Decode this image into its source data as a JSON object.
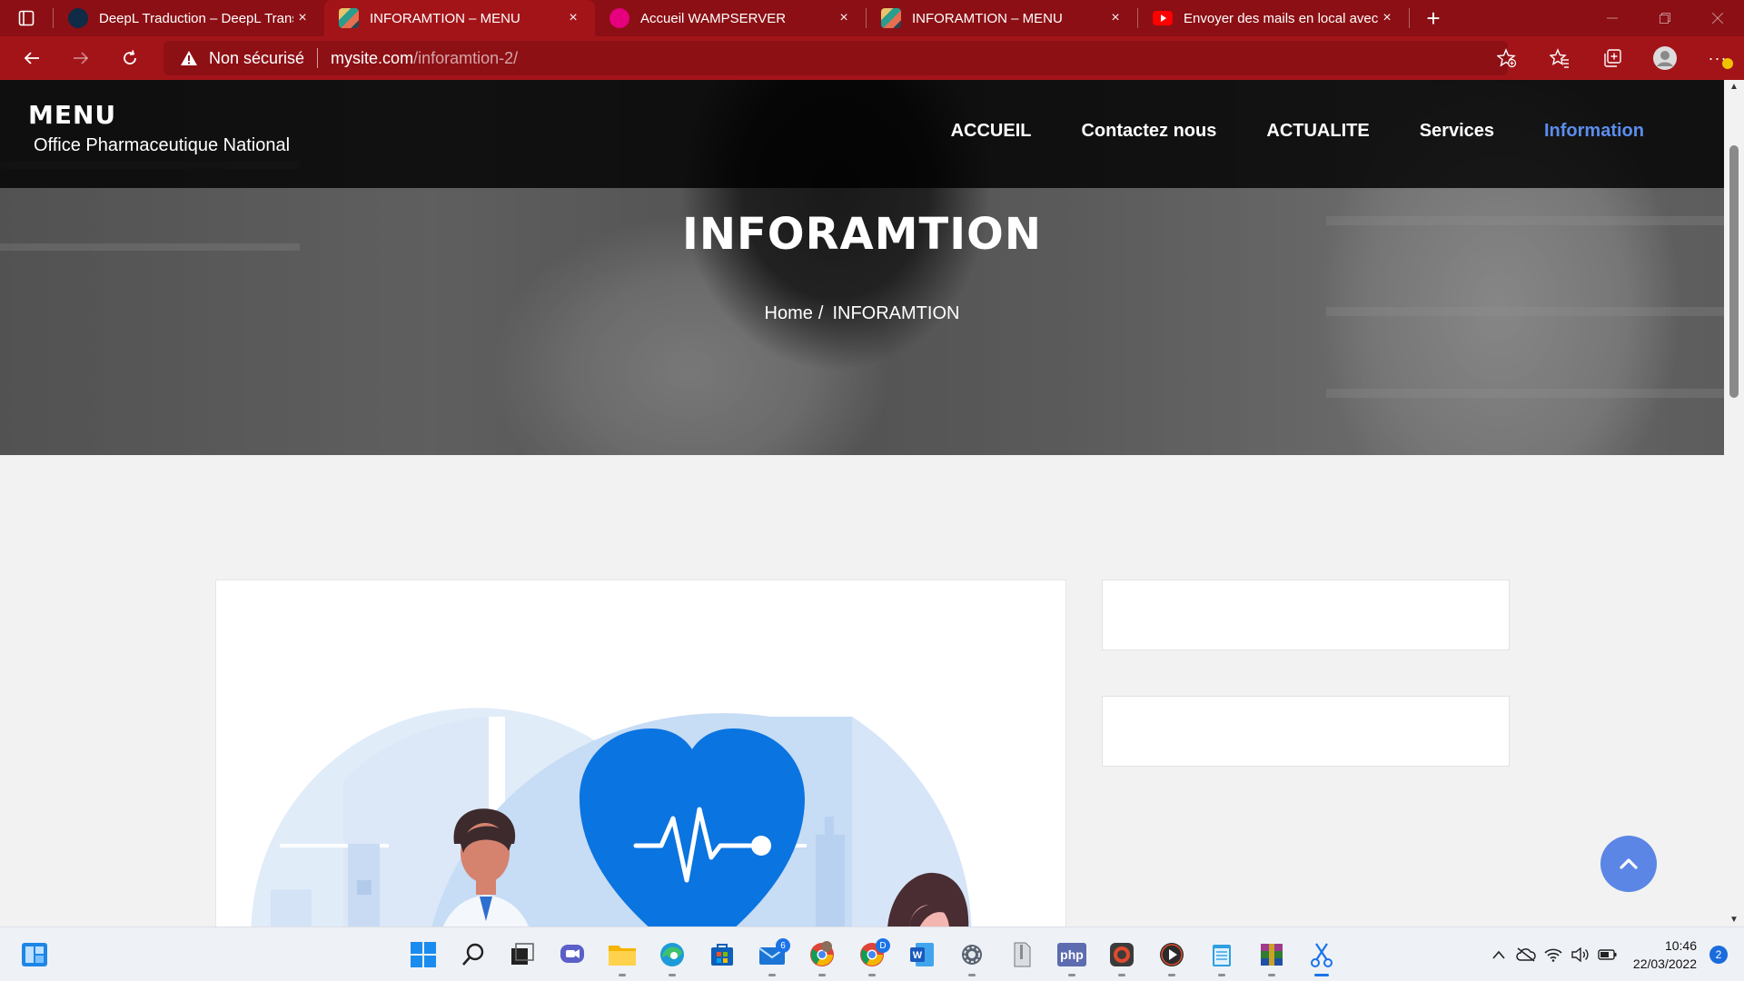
{
  "browser": {
    "tabs": [
      {
        "title": "DeepL Traduction – DeepL Transl",
        "icon": "deepl-icon",
        "active": false
      },
      {
        "title": "INFORAMTION – MENU",
        "icon": "site-icon",
        "active": true
      },
      {
        "title": "Accueil WAMPSERVER",
        "icon": "wamp-icon",
        "active": false
      },
      {
        "title": "INFORAMTION – MENU",
        "icon": "site-icon",
        "active": false
      },
      {
        "title": "Envoyer des mails en local avec",
        "icon": "youtube-icon",
        "active": false
      }
    ],
    "close_glyph": "×",
    "new_tab_glyph": "+",
    "security_label": "Non sécurisé",
    "url_host": "mysite.com",
    "url_path": "/inforamtion-2/",
    "colors": {
      "tab_strip": "#8b0f14",
      "toolbar": "#a31419"
    }
  },
  "site": {
    "logo": "MENU",
    "tagline": "Office Pharmaceutique National",
    "nav": [
      {
        "label": "ACCUEIL",
        "current": false
      },
      {
        "label": "Contactez nous",
        "current": false
      },
      {
        "label": "ACTUALITE",
        "current": false
      },
      {
        "label": "Services",
        "current": false
      },
      {
        "label": "Information",
        "current": true
      }
    ],
    "accent_color": "#5b8def"
  },
  "hero": {
    "title": "INFORAMTION",
    "breadcrumb_home": "Home",
    "breadcrumb_sep": "/",
    "breadcrumb_current": "INFORAMTION"
  },
  "taskbar": {
    "time": "10:46",
    "date": "22/03/2022",
    "mail_badge": "6",
    "chrome_badge": "D",
    "notification_count": "2",
    "php_label": "php"
  }
}
